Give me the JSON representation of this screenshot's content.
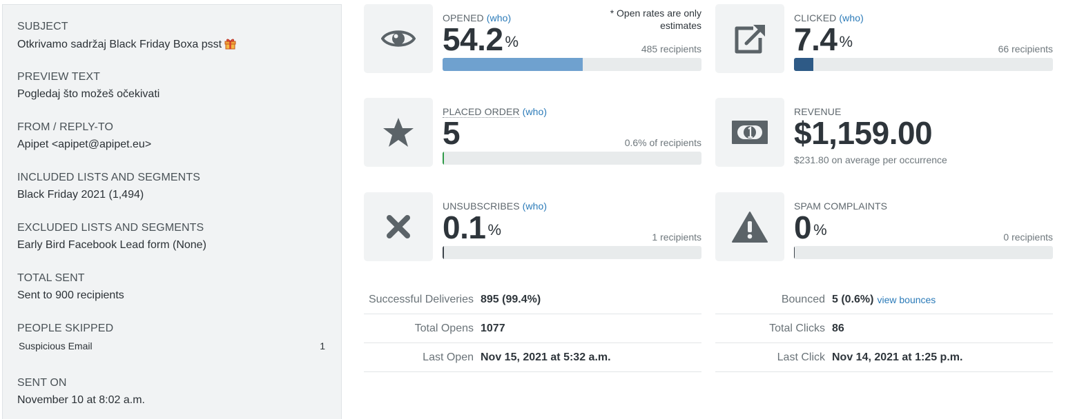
{
  "sidebar": {
    "subject": {
      "label": "SUBJECT",
      "value": "Otkrivamo sadržaj Black Friday Boxa psst"
    },
    "preview": {
      "label": "PREVIEW TEXT",
      "value": "Pogledaj što možeš očekivati"
    },
    "from": {
      "label": "FROM / REPLY-TO",
      "value": "Apipet <apipet@apipet.eu>"
    },
    "included": {
      "label": "INCLUDED LISTS AND SEGMENTS",
      "value": "Black Friday 2021 (1,494)"
    },
    "excluded": {
      "label": "EXCLUDED LISTS AND SEGMENTS",
      "value": "Early Bird Facebook Lead form (None)"
    },
    "total_sent": {
      "label": "TOTAL SENT",
      "value": "Sent to 900 recipients"
    },
    "skipped": {
      "label": "PEOPLE SKIPPED",
      "reason": "Suspicious Email",
      "count": "1"
    },
    "sent_on": {
      "label": "SENT ON",
      "value": "November 10 at 8:02 a.m."
    }
  },
  "metrics": {
    "opened": {
      "label": "OPENED",
      "who": "(who)",
      "value": "54.2",
      "unit": "%",
      "disclaimer": "* Open rates are only estimates",
      "note": "485 recipients",
      "fraction": 0.542,
      "bar_color": "#6fa1cf",
      "icon": "eye-icon"
    },
    "clicked": {
      "label": "CLICKED",
      "who": "(who)",
      "value": "7.4",
      "unit": "%",
      "note": "66 recipients",
      "fraction": 0.074,
      "bar_color": "#2e5a86",
      "icon": "external-link-icon"
    },
    "placed_order": {
      "label": "PLACED ORDER",
      "who": "(who)",
      "value": "5",
      "note": "0.6% of recipients",
      "fraction": 0.006,
      "bar_color": "#2e9a48",
      "icon": "star-icon"
    },
    "revenue": {
      "label": "REVENUE",
      "value": "$1,159.00",
      "sub": "$231.80 on average per occurrence",
      "icon": "money-bill-icon"
    },
    "unsubscribes": {
      "label": "UNSUBSCRIBES",
      "who": "(who)",
      "value": "0.1",
      "unit": "%",
      "note": "1 recipients",
      "fraction": 0.001,
      "bar_color": "#3b4249",
      "icon": "x-icon"
    },
    "spam": {
      "label": "SPAM COMPLAINTS",
      "value": "0",
      "unit": "%",
      "note": "0 recipients",
      "fraction": 0,
      "bar_color": "#3b4249",
      "icon": "warning-icon"
    }
  },
  "stats_left": [
    {
      "key": "Successful Deliveries",
      "value": "895 (99.4%)"
    },
    {
      "key": "Total Opens",
      "value": "1077"
    },
    {
      "key": "Last Open",
      "value": "Nov 15, 2021 at 5:32 a.m."
    }
  ],
  "stats_right": [
    {
      "key": "Bounced",
      "value": "5 (0.6%)",
      "link": "view bounces"
    },
    {
      "key": "Total Clicks",
      "value": "86"
    },
    {
      "key": "Last Click",
      "value": "Nov 14, 2021 at 1:25 p.m."
    }
  ],
  "colors": {
    "link": "#2a7ab8",
    "icon": "#5b6368",
    "panel": "#f1f3f4"
  }
}
